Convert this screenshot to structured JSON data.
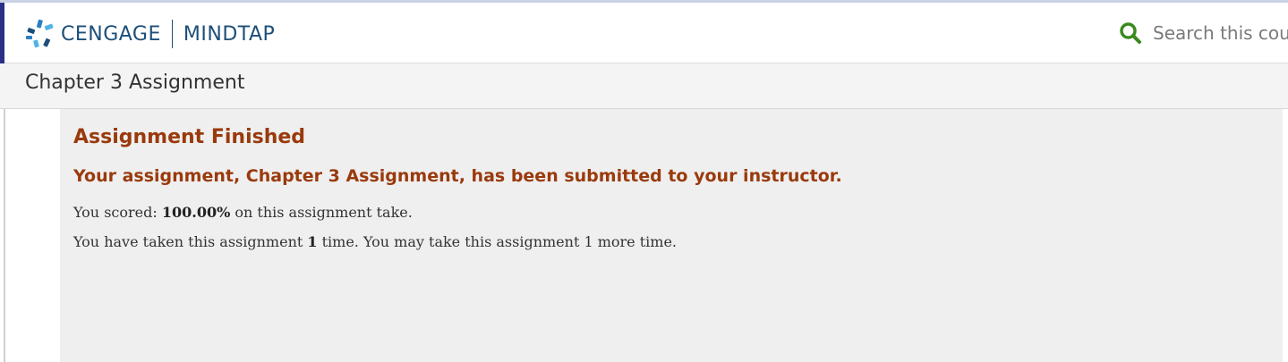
{
  "header": {
    "brand": "CENGAGE",
    "product": "MINDTAP",
    "search_placeholder": "Search this course"
  },
  "subheader": {
    "title": "Chapter 3 Assignment"
  },
  "result": {
    "heading": "Assignment Finished",
    "submitted_message": "Your assignment, Chapter 3 Assignment, has been submitted to your instructor.",
    "score_prefix": "You scored: ",
    "score_value": "100.00%",
    "score_suffix": " on this assignment take.",
    "taken_prefix": "You have taken this assignment ",
    "taken_count": "1",
    "taken_suffix": " time. You may take this assignment 1 more time."
  },
  "colors": {
    "brand_blue": "#1d4f7a",
    "accent_heading": "#9a3a0c",
    "search_green": "#3a8a1f",
    "nav_accent": "#2b2f86"
  },
  "icons": {
    "logo": "cengage-logo-icon",
    "search": "search-icon"
  }
}
